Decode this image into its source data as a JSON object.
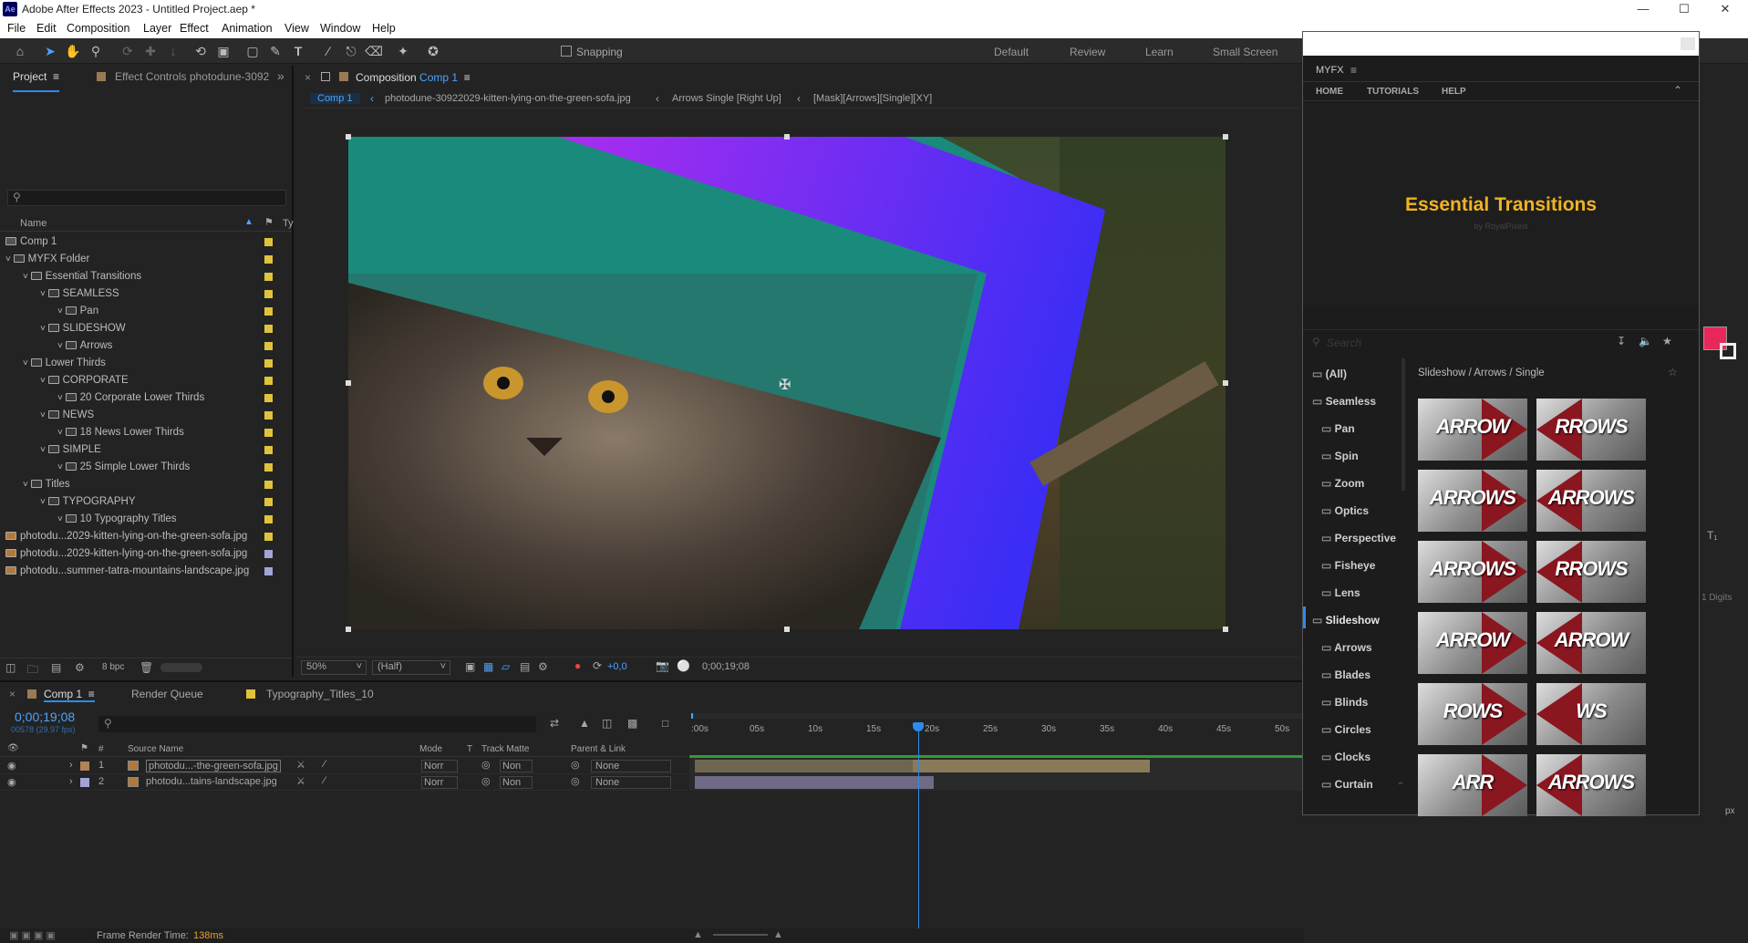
{
  "window": {
    "title": "Adobe After Effects 2023 - Untitled Project.aep *",
    "logo": "Ae"
  },
  "menu": [
    "File",
    "Edit",
    "Composition",
    "Layer",
    "Effect",
    "Animation",
    "View",
    "Window",
    "Help"
  ],
  "toolbar": {
    "snapping": "Snapping",
    "workspaces": [
      "Default",
      "Review",
      "Learn",
      "Small Screen"
    ]
  },
  "project": {
    "tab_project": "Project",
    "tab_effect": "Effect Controls photodune-3092",
    "search_placeholder": "",
    "col_name": "Name",
    "col_type": "Ty",
    "bpc": "8 bpc",
    "items": [
      {
        "label": "Comp 1",
        "indent": 0,
        "type": "comp",
        "color": "yellow"
      },
      {
        "label": "MYFX Folder",
        "indent": 0,
        "type": "folder",
        "color": "yellow"
      },
      {
        "label": "Essential Transitions",
        "indent": 1,
        "type": "folder",
        "color": "yellow"
      },
      {
        "label": "SEAMLESS",
        "indent": 2,
        "type": "folder",
        "color": "yellow"
      },
      {
        "label": "Pan",
        "indent": 3,
        "type": "folder",
        "color": "yellow"
      },
      {
        "label": "SLIDESHOW",
        "indent": 2,
        "type": "folder",
        "color": "yellow"
      },
      {
        "label": "Arrows",
        "indent": 3,
        "type": "folder",
        "color": "yellow"
      },
      {
        "label": "Lower Thirds",
        "indent": 1,
        "type": "folder",
        "color": "yellow"
      },
      {
        "label": "CORPORATE",
        "indent": 2,
        "type": "folder",
        "color": "yellow"
      },
      {
        "label": "20 Corporate Lower Thirds",
        "indent": 3,
        "type": "folder",
        "color": "yellow"
      },
      {
        "label": "NEWS",
        "indent": 2,
        "type": "folder",
        "color": "yellow"
      },
      {
        "label": "18 News Lower Thirds",
        "indent": 3,
        "type": "folder",
        "color": "yellow"
      },
      {
        "label": "SIMPLE",
        "indent": 2,
        "type": "folder",
        "color": "yellow"
      },
      {
        "label": "25 Simple Lower Thirds",
        "indent": 3,
        "type": "folder",
        "color": "yellow"
      },
      {
        "label": "Titles",
        "indent": 1,
        "type": "folder",
        "color": "yellow"
      },
      {
        "label": "TYPOGRAPHY",
        "indent": 2,
        "type": "folder",
        "color": "yellow"
      },
      {
        "label": "10 Typography Titles",
        "indent": 3,
        "type": "folder",
        "color": "yellow"
      },
      {
        "label": "photodu...2029-kitten-lying-on-the-green-sofa.jpg",
        "indent": 0,
        "type": "image",
        "color": "yellow"
      },
      {
        "label": "photodu...2029-kitten-lying-on-the-green-sofa.jpg",
        "indent": 0,
        "type": "image",
        "color": "blue"
      },
      {
        "label": "photodu...summer-tatra-mountains-landscape.jpg",
        "indent": 0,
        "type": "image",
        "color": "blue"
      }
    ]
  },
  "comp": {
    "tab_label": "Composition",
    "comp_name": "Comp 1",
    "breadcrumbs": [
      "Comp 1",
      "photodune-30922029-kitten-lying-on-the-green-sofa.jpg",
      "Arrows Single [Right Up]",
      "[Mask][Arrows][Single][XY]"
    ],
    "zoom": "50%",
    "resolution": "(Half)",
    "exposure": "+0,0",
    "timecode": "0;00;19;08"
  },
  "timeline": {
    "tab_comp": "Comp 1",
    "tab_render": "Render Queue",
    "tab_typo": "Typography_Titles_10",
    "timecode": "0;00;19;08",
    "fps": "00578 (29.97 fps)",
    "col_source": "Source Name",
    "col_mode": "Mode",
    "col_t": "T",
    "col_track": "Track Matte",
    "col_parent": "Parent & Link",
    "ruler": [
      ":00s",
      "05s",
      "10s",
      "15s",
      "20s",
      "25s",
      "30s",
      "35s",
      "40s",
      "45s",
      "50s"
    ],
    "layers": [
      {
        "num": "1",
        "name": "photodu...-the-green-sofa.jpg",
        "mode": "Norr",
        "matte": "Non",
        "parent": "None"
      },
      {
        "num": "2",
        "name": "photodu...tains-landscape.jpg",
        "mode": "Norr",
        "matte": "Non",
        "parent": "None"
      }
    ],
    "render_label": "Frame Render Time:",
    "render_value": "138ms"
  },
  "myfx": {
    "title": "MYFX",
    "nav": [
      "HOME",
      "TUTORIALS",
      "HELP"
    ],
    "banner": "Essential Transitions",
    "banner_sub": "by RoyalPixels",
    "search_placeholder": "Search",
    "path": "Slideshow / Arrows / Single",
    "categories": [
      "(All)",
      "Seamless",
      "Pan",
      "Spin",
      "Zoom",
      "Optics",
      "Perspective",
      "Fisheye",
      "Lens",
      "Slideshow",
      "Arrows",
      "Blades",
      "Blinds",
      "Circles",
      "Clocks",
      "Curtain"
    ],
    "thumbs": [
      "ARROW",
      "RROWS",
      "ARROWS",
      "ARROWS",
      "ARROWS",
      "RROWS",
      "ARROW",
      "ARROW",
      "ROWS",
      "WS",
      "ARR",
      "ARROWS"
    ]
  },
  "right": {
    "digits": "1 Digits",
    "px": "px"
  },
  "colors": {
    "accent": "#2d8ceb",
    "label_yellow": "#e0c33b",
    "label_blue": "#a3a3d8",
    "banner_gold": "#f0b323",
    "playhead": "#2d8ceb"
  }
}
